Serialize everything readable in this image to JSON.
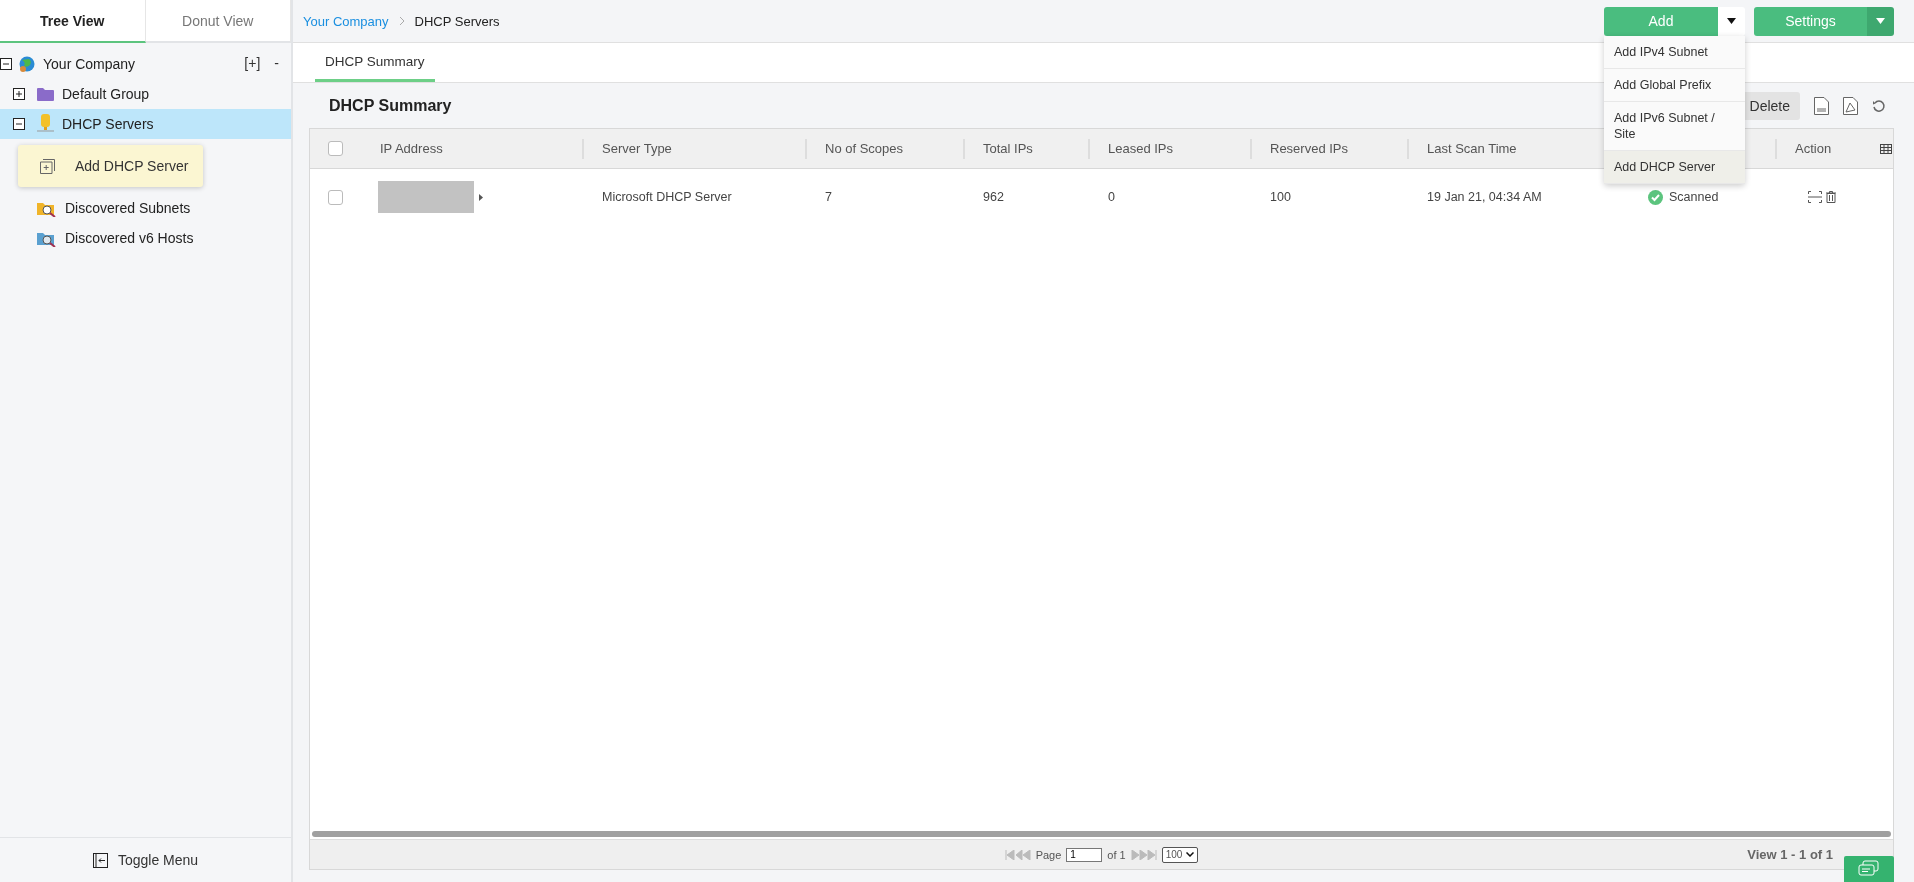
{
  "sidebar": {
    "tabs": [
      {
        "label": "Tree View",
        "selected": true
      },
      {
        "label": "Donut View",
        "selected": false
      }
    ],
    "tree_controls": {
      "expand_all": "[+]",
      "collapse_all": "-"
    },
    "tree": [
      {
        "label": "Your Company",
        "kind": "node",
        "expanded": true,
        "selected": false,
        "children": [
          {
            "label": "Default Group",
            "kind": "node",
            "expanded": false,
            "selected": false
          },
          {
            "label": "DHCP Servers",
            "kind": "node",
            "expanded": true,
            "selected": true
          },
          {
            "label": "Discovered Subnets",
            "kind": "leaf",
            "selected": false
          },
          {
            "label": "Discovered v6 Hosts",
            "kind": "leaf",
            "selected": false
          }
        ]
      }
    ],
    "context_menu": {
      "items": [
        "Add DHCP Server"
      ]
    },
    "toggle_menu": "Toggle Menu"
  },
  "breadcrumb": [
    "Your Company",
    "DHCP Servers"
  ],
  "header_buttons": {
    "add": "Add",
    "settings": "Settings"
  },
  "add_menu": [
    {
      "label": "Add IPv4 Subnet",
      "selected": false
    },
    {
      "label": "Add Global Prefix",
      "selected": false
    },
    {
      "label": "Add IPv6 Subnet / Site",
      "selected": false
    },
    {
      "label": "Add DHCP Server",
      "selected": true
    }
  ],
  "subtabs": [
    {
      "label": "DHCP Summary",
      "selected": true
    }
  ],
  "panel": {
    "title": "DHCP Summary",
    "delete": "Delete"
  },
  "table": {
    "all_checked": false,
    "columns": [
      "IP Address",
      "Server Type",
      "No of Scopes",
      "Total IPs",
      "Leased IPs",
      "Reserved IPs",
      "Last Scan Time",
      null,
      "Action"
    ],
    "rows": [
      {
        "checked": false,
        "redacted": true,
        "cells": [
          "",
          "Microsoft DHCP Server",
          "7",
          "962",
          "0",
          "100",
          "19 Jan 21, 04:34 AM",
          "Scanned"
        ]
      }
    ]
  },
  "pager": {
    "page_label": "Page",
    "page": "1",
    "of": "of 1",
    "page_size": "100",
    "view": "View 1 - 1 of 1"
  }
}
